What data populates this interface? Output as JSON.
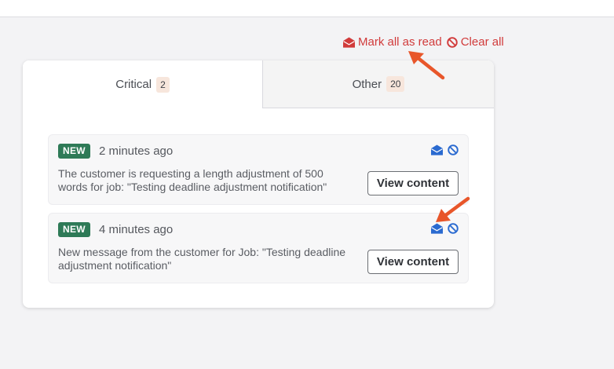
{
  "colors": {
    "accent_red": "#d13b3b",
    "badge_green": "#2e7a57",
    "icon_blue": "#2a6ad0",
    "annotation_arrow": "#e8562a"
  },
  "actions": {
    "mark_all_read": "Mark all as read",
    "clear_all": "Clear all"
  },
  "tabs": [
    {
      "label": "Critical",
      "count": "2",
      "active": true
    },
    {
      "label": "Other",
      "count": "20",
      "active": false
    }
  ],
  "notifications": [
    {
      "badge": "NEW",
      "time": "2 minutes ago",
      "message": "The customer is requesting a length adjustment of 500 words for job: \"Testing deadline adjustment notification\"",
      "button": "View content"
    },
    {
      "badge": "NEW",
      "time": "4 minutes ago",
      "message": "New message from the customer for Job: \"Testing deadline adjustment notification\"",
      "button": "View content"
    }
  ],
  "icons": {
    "mark_read": "envelope-open-icon",
    "clear": "ban-icon"
  }
}
